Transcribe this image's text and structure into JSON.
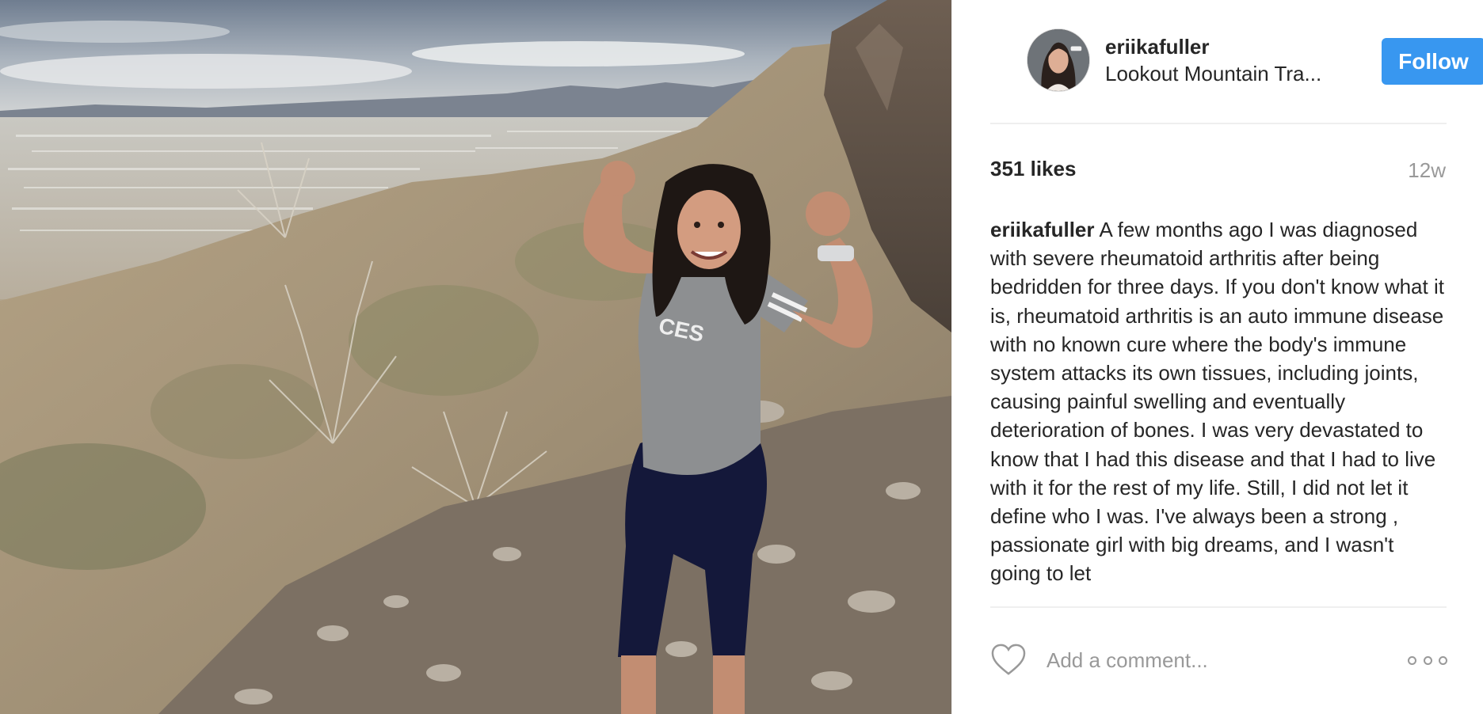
{
  "photo": {
    "alt_icon": "hiking-photo"
  },
  "header": {
    "username": "eriikafuller",
    "location": "Lookout Mountain Tra...",
    "follow_label": "Follow"
  },
  "stats": {
    "likes": "351 likes",
    "time_ago": "12w"
  },
  "caption": {
    "username": "eriikafuller",
    "text": "A few months ago I was diagnosed with severe rheumatoid arthritis after being bedridden for three days. If you don't know what it is, rheumatoid arthritis is an auto immune disease with no known cure where the body's immune system attacks its own tissues, including joints, causing painful swelling and eventually deterioration of bones. I was very devastated to know that I had this disease and that I had to live with it for the rest of my life. Still, I did not let it define who I was. I've always been a strong , passionate girl with big dreams, and I wasn't going to let"
  },
  "comment": {
    "placeholder": "Add a comment..."
  },
  "colors": {
    "follow_button": "#3897f0",
    "muted_text": "#999999",
    "primary_text": "#262626"
  }
}
